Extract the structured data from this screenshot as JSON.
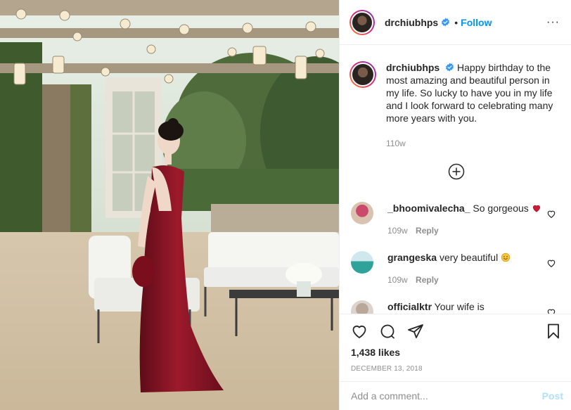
{
  "header": {
    "username": "drchiubhps",
    "separator": "•",
    "follow_label": "Follow",
    "more_label": "···"
  },
  "caption": {
    "username": "drchiubhps",
    "text": "Happy birthday to the most amazing and beautiful person in my life. So lucky to have you in my life and I look forward to celebrating many more years with you.",
    "time": "110w"
  },
  "comments": [
    {
      "username": "_bhoomivalecha_",
      "text": "So gorgeous",
      "time": "109w",
      "reply_label": "Reply"
    },
    {
      "username": "grangeska",
      "text": "very beautiful",
      "time": "109w",
      "reply_label": "Reply"
    },
    {
      "username": "officialktr",
      "text": "Your wife is"
    }
  ],
  "actions": {
    "likes": "1,438 likes",
    "date": "December 13, 2018"
  },
  "add_comment": {
    "placeholder": "Add a comment...",
    "post_label": "Post"
  },
  "colors": {
    "link_blue": "#0095f6",
    "muted": "#8e8e8e",
    "post_disabled": "#b2dffc",
    "dress": "#8b1424"
  }
}
